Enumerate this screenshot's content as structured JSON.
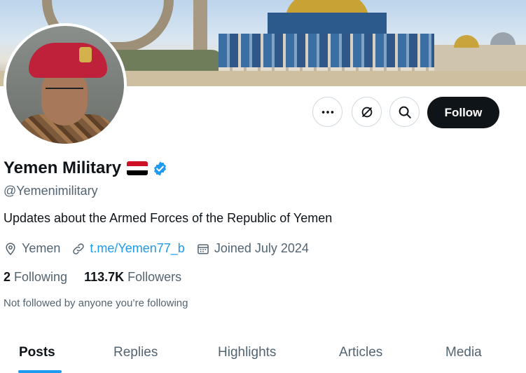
{
  "profile": {
    "display_name": "Yemen Military",
    "flag_emoji": "yemen-flag",
    "handle": "@Yemenimilitary",
    "bio": "Updates about the Armed Forces of the Republic of Yemen",
    "location": "Yemen",
    "website": "t.me/Yemen77_b",
    "joined": "Joined July 2024",
    "following_count": "2",
    "following_label": "Following",
    "followers_count": "113.7K",
    "followers_label": "Followers",
    "followed_by_note": "Not followed by anyone you’re following"
  },
  "actions": {
    "more_icon": "more-icon",
    "grok_icon": "grok-icon",
    "search_icon": "search-icon",
    "follow_label": "Follow"
  },
  "tabs": [
    {
      "label": "Posts",
      "active": true
    },
    {
      "label": "Replies",
      "active": false
    },
    {
      "label": "Highlights",
      "active": false
    },
    {
      "label": "Articles",
      "active": false
    },
    {
      "label": "Media",
      "active": false
    }
  ],
  "colors": {
    "accent": "#1d9bf0",
    "primary_text": "#0f1419",
    "secondary_text": "#536471",
    "follow_bg": "#0f1419"
  }
}
